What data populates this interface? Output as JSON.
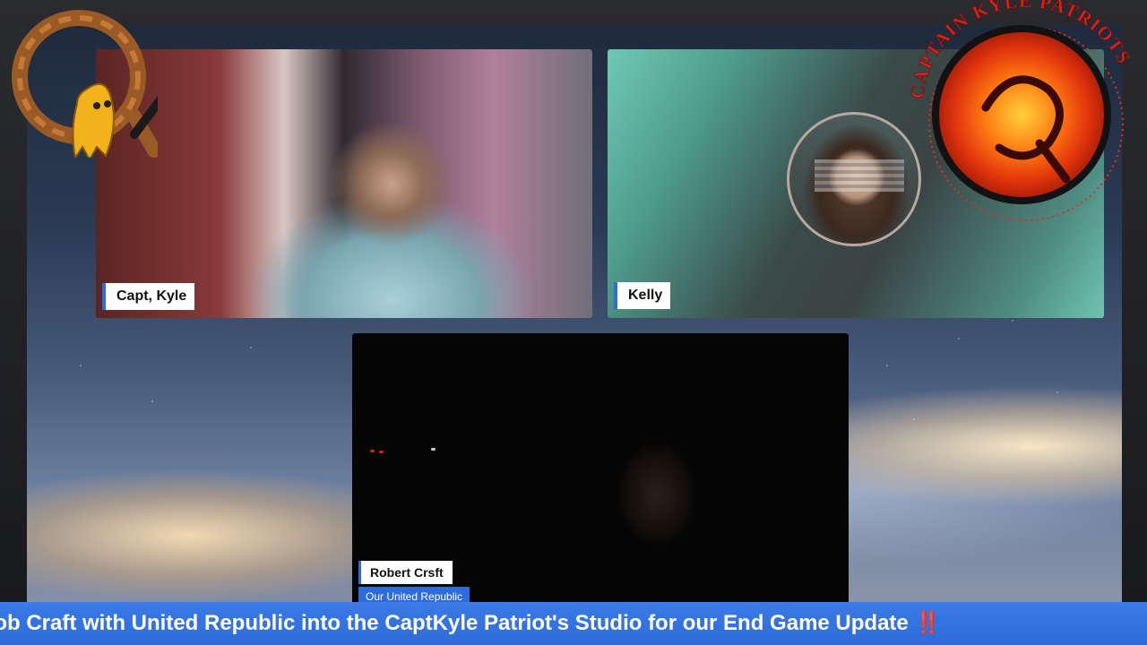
{
  "participants": [
    {
      "name": "Capt, Kyle"
    },
    {
      "name": "Kelly"
    },
    {
      "name": "Robert Crsft",
      "subtitle": "Our United Republic"
    }
  ],
  "brand": {
    "logo_text": "CAPTAIN KYLE PATRIOTS",
    "q_logo": "Q"
  },
  "ticker": {
    "text": "e Bob Craft with United Republic into the CaptKyle Patriot's Studio for our End Game Update",
    "end_mark": "‼️"
  },
  "colors": {
    "accent": "#2e6bd9",
    "name_tag_bg": "#ffffff",
    "ticker_bg": "#2e6bd9"
  }
}
